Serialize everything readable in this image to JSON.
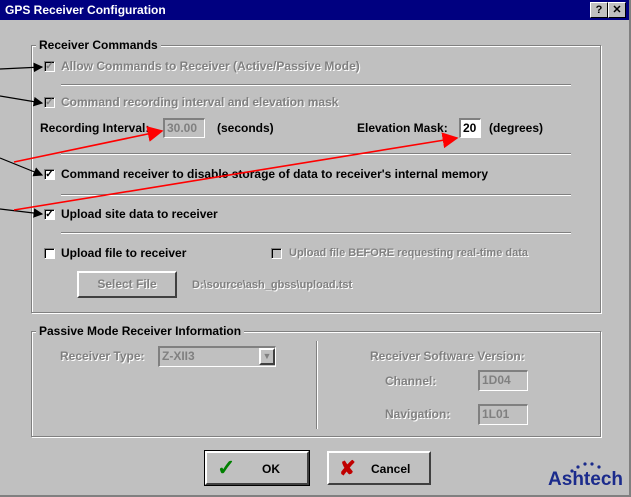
{
  "window": {
    "title": "GPS Receiver Configuration",
    "help_glyph": "?",
    "close_glyph": "✕"
  },
  "receiver_commands": {
    "legend": "Receiver Commands",
    "allow_commands_label": "Allow Commands to Receiver (Active/Passive Mode)",
    "allow_commands_checked": true,
    "allow_commands_enabled": false,
    "recording_interval_label": "Command recording interval and elevation mask",
    "recording_interval_checked": true,
    "recording_interval_enabled": false,
    "interval_label": "Recording Interval:",
    "interval_value": "30.00",
    "interval_unit": "(seconds)",
    "elevation_label": "Elevation Mask:",
    "elevation_value": "20",
    "elevation_unit": "(degrees)",
    "disable_storage_label": "Command receiver to disable storage of data to receiver's internal memory",
    "disable_storage_checked": true,
    "upload_site_label": "Upload site data to receiver",
    "upload_site_checked": true,
    "upload_file_label": "Upload file to receiver",
    "upload_file_checked": false,
    "upload_before_label": "Upload file BEFORE requesting real-time data",
    "upload_before_checked": false,
    "select_file_label": "Select File",
    "file_path": "D:\\source\\ash_gbss\\upload.tst"
  },
  "passive_mode": {
    "legend": "Passive Mode Receiver Information",
    "receiver_type_label": "Receiver Type:",
    "receiver_type_value": "Z-XII3",
    "software_version_label": "Receiver Software Version:",
    "channel_label": "Channel:",
    "channel_value": "1D04",
    "navigation_label": "Navigation:",
    "navigation_value": "1L01"
  },
  "buttons": {
    "ok_label": "OK",
    "cancel_label": "Cancel"
  },
  "logo_text": "Ashtech",
  "check_glyph": "✓",
  "colors": {
    "title_bar": "#000080",
    "window_face": "#c0c0c0",
    "annotation_arrow": "#ff0000",
    "ok_check": "#008000",
    "cancel_x": "#c00000"
  }
}
